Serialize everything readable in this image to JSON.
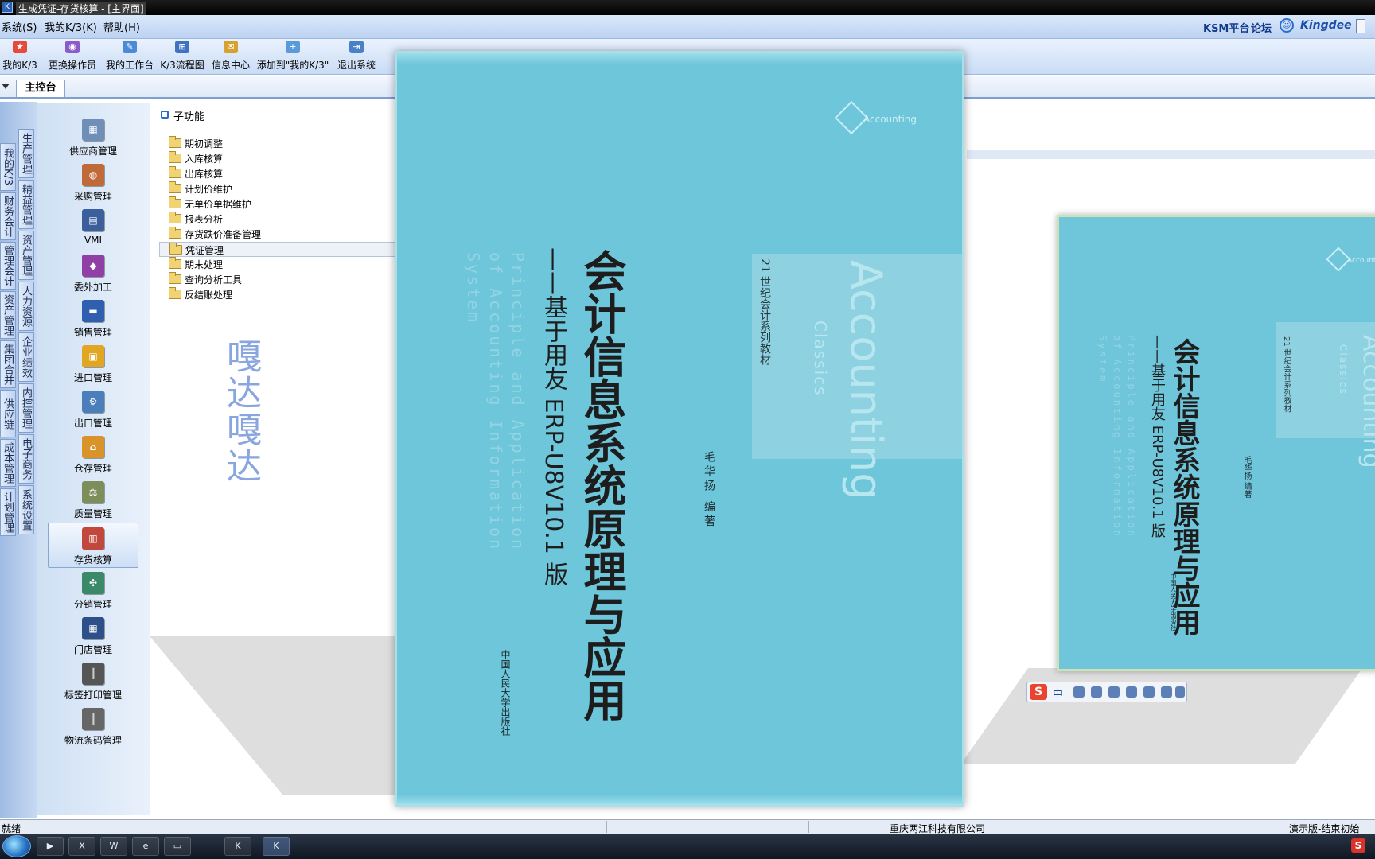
{
  "window": {
    "title": "生成凭证-存货核算 - [主界面]"
  },
  "menu": {
    "system": "系统(S)",
    "mine": "我的K/3(K)",
    "help": "帮助(H)"
  },
  "top_right": {
    "ksm": "KSM平台",
    "forum": "论坛",
    "brand": "Kingdee"
  },
  "toolbar": {
    "my_k3": "我的K/3",
    "change_operator": "更换操作员",
    "workbench": "我的工作台",
    "flowchart": "K/3流程图",
    "messages": "信息中心",
    "add_to_mine": "添加到\"我的K/3\"",
    "exit": "退出系统"
  },
  "tabs": {
    "main_console": "主控台"
  },
  "vtabs": {
    "col1": [
      "我的K/3",
      "财务会计",
      "管理会计",
      "资产管理",
      "集团合并",
      "供应链",
      "成本管理",
      "计划管理"
    ],
    "col2": [
      "生产管理",
      "精益管理",
      "资产管理",
      "人力资源",
      "企业绩效",
      "内控管理",
      "电子商务",
      "系统设置"
    ]
  },
  "modules": [
    "供应商管理",
    "采购管理",
    "VMI",
    "委外加工",
    "销售管理",
    "进口管理",
    "出口管理",
    "仓存管理",
    "质量管理",
    "存货核算",
    "分销管理",
    "门店管理",
    "标签打印管理",
    "物流条码管理"
  ],
  "selected_module": "存货核算",
  "subpanel": {
    "header": "子功能",
    "items": [
      "期初调整",
      "入库核算",
      "出库核算",
      "计划价维护",
      "无单价单据维护",
      "报表分析",
      "存货跌价准备管理",
      "凭证管理",
      "期末处理",
      "查询分析工具",
      "反结账处理"
    ],
    "selected": "凭证管理"
  },
  "watermark": "嘎达嘎达",
  "status": {
    "left": "就绪",
    "company": "重庆两江科技有限公司",
    "right": "演示版-结束初始"
  },
  "book": {
    "title": "会计信息系统原理与应用",
    "subtitle": "——基于用友 ERP-U8V10.1 版",
    "english_1": "Principle and Application",
    "english_2": "of Accounting Information",
    "english_3": "System",
    "series": "21 世纪会计系列教材",
    "accounting": "Accounting",
    "classics": "Classics",
    "author": "毛华扬 编著",
    "publisher": "中国人民大学出版社",
    "emblem": "Accounting"
  },
  "ime": {
    "mode": "中"
  },
  "colors": {
    "cover": "#6ec6db",
    "accent": "#2c6fce",
    "menubar": "#bcd2f2"
  }
}
